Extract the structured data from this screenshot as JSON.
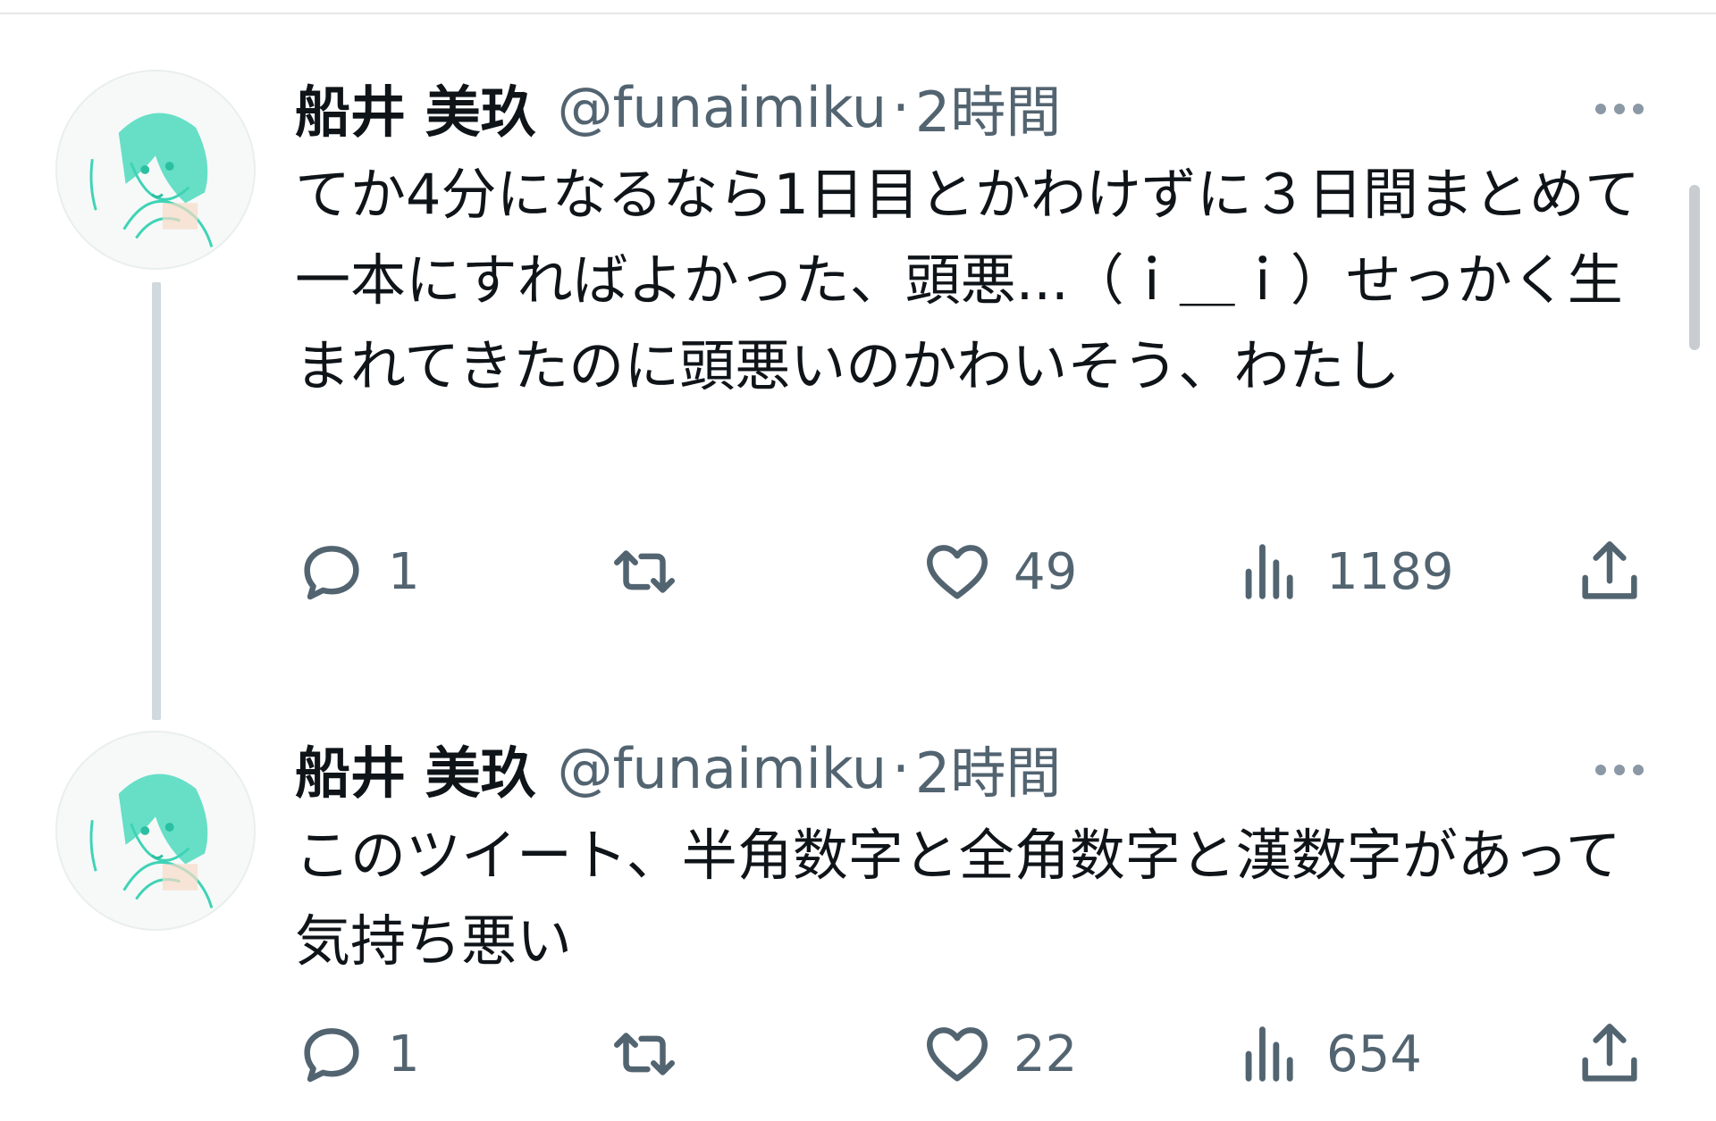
{
  "colors": {
    "text_primary": "#0f1419",
    "text_secondary": "#536471",
    "thread_line": "#cfd9de",
    "avatar_accent": "#3fd3b6"
  },
  "tweets": [
    {
      "display_name": "船井 美玖",
      "handle": "@funaimiku",
      "separator": "·",
      "time": "2時間",
      "text": "てか4分になるなら1日目とかわけずに３日間まとめて一本にすればよかった、頭悪...（ｉ＿ｉ）せっかく生まれてきたのに頭悪いのかわいそう、わたし",
      "replies": "1",
      "retweets": "",
      "likes": "49",
      "views": "1189"
    },
    {
      "display_name": "船井 美玖",
      "handle": "@funaimiku",
      "separator": "·",
      "time": "2時間",
      "text": "このツイート、半角数字と全角数字と漢数字があって気持ち悪い",
      "replies": "1",
      "retweets": "",
      "likes": "22",
      "views": "654"
    }
  ],
  "icons": {
    "more": "more-icon",
    "reply": "reply-icon",
    "retweet": "retweet-icon",
    "like": "heart-icon",
    "views": "views-icon",
    "share": "share-icon"
  }
}
